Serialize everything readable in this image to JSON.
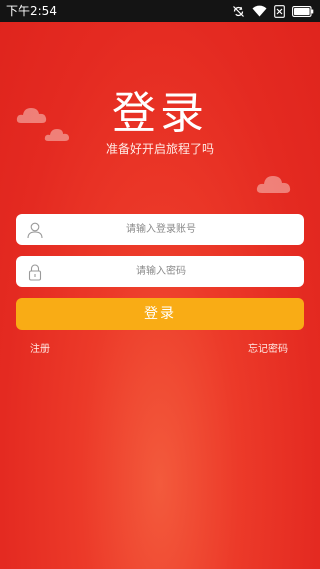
{
  "status_bar": {
    "time": "下午2:54",
    "icons": [
      "sync-off-icon",
      "wifi-icon",
      "sim-off-icon",
      "battery-icon"
    ]
  },
  "header": {
    "title": "登录",
    "subtitle": "准备好开启旅程了吗"
  },
  "form": {
    "username": {
      "placeholder": "请输入登录账号",
      "value": "",
      "icon": "user-icon"
    },
    "password": {
      "placeholder": "请输入密码",
      "value": "",
      "icon": "lock-icon"
    },
    "login_label": "登录"
  },
  "links": {
    "register": "注册",
    "forgot_password": "忘记密码"
  },
  "colors": {
    "background": "#e52a22",
    "button": "#f9ac15",
    "status_bar": "#141414"
  }
}
